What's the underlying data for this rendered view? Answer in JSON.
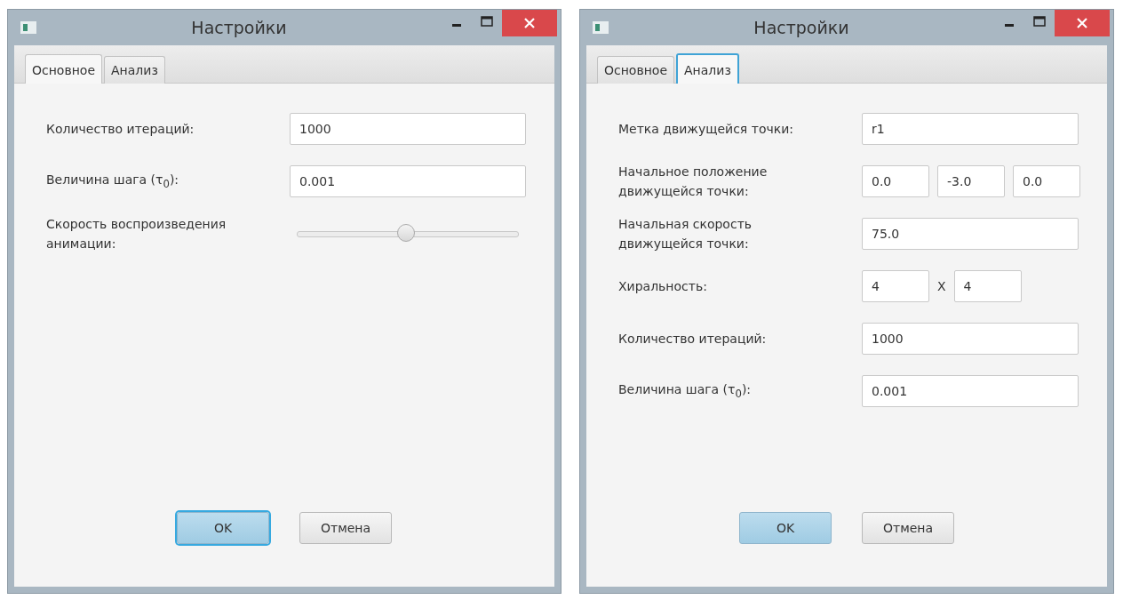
{
  "windows": [
    {
      "title": "Настройки",
      "tabs": [
        {
          "label": "Основное",
          "selected": true
        },
        {
          "label": "Анализ",
          "selected": false
        }
      ],
      "rows": [
        {
          "kind": "text",
          "label": "Количество итераций:",
          "values": [
            "1000"
          ]
        },
        {
          "kind": "text",
          "label": "Величина шага (τ$_{0}$):",
          "values": [
            "0.001"
          ]
        },
        {
          "kind": "slider",
          "label": "Скорость воспроизведения анимации:",
          "level": 0.49
        }
      ],
      "buttons": [
        {
          "label": "OK",
          "kind": "default",
          "focused": true
        },
        {
          "label": "Отмена",
          "kind": "normal",
          "focused": false
        }
      ]
    },
    {
      "title": "Настройки",
      "tabs": [
        {
          "label": "Основное",
          "selected": false
        },
        {
          "label": "Анализ",
          "selected": true
        }
      ],
      "rows": [
        {
          "kind": "text",
          "label": "Метка движущейся точки:",
          "values": [
            "r1"
          ]
        },
        {
          "kind": "multi",
          "label": "Начальное положение движущейся точки:",
          "values": [
            "0.0",
            "-3.0",
            "0.0"
          ]
        },
        {
          "kind": "text",
          "label": "Начальная скорость движущейся точки:",
          "values": [
            "75.0"
          ]
        },
        {
          "kind": "multi",
          "label": "Хиральность:",
          "values": [
            "4",
            "4"
          ],
          "separator": "X"
        },
        {
          "kind": "text",
          "label": "Количество итераций:",
          "values": [
            "1000"
          ]
        },
        {
          "kind": "text",
          "label": "Величина шага (τ$_{0}$):",
          "values": [
            "0.001"
          ]
        }
      ],
      "buttons": [
        {
          "label": "OK",
          "kind": "default",
          "focused": false
        },
        {
          "label": "Отмена",
          "kind": "normal",
          "focused": false
        }
      ]
    }
  ]
}
